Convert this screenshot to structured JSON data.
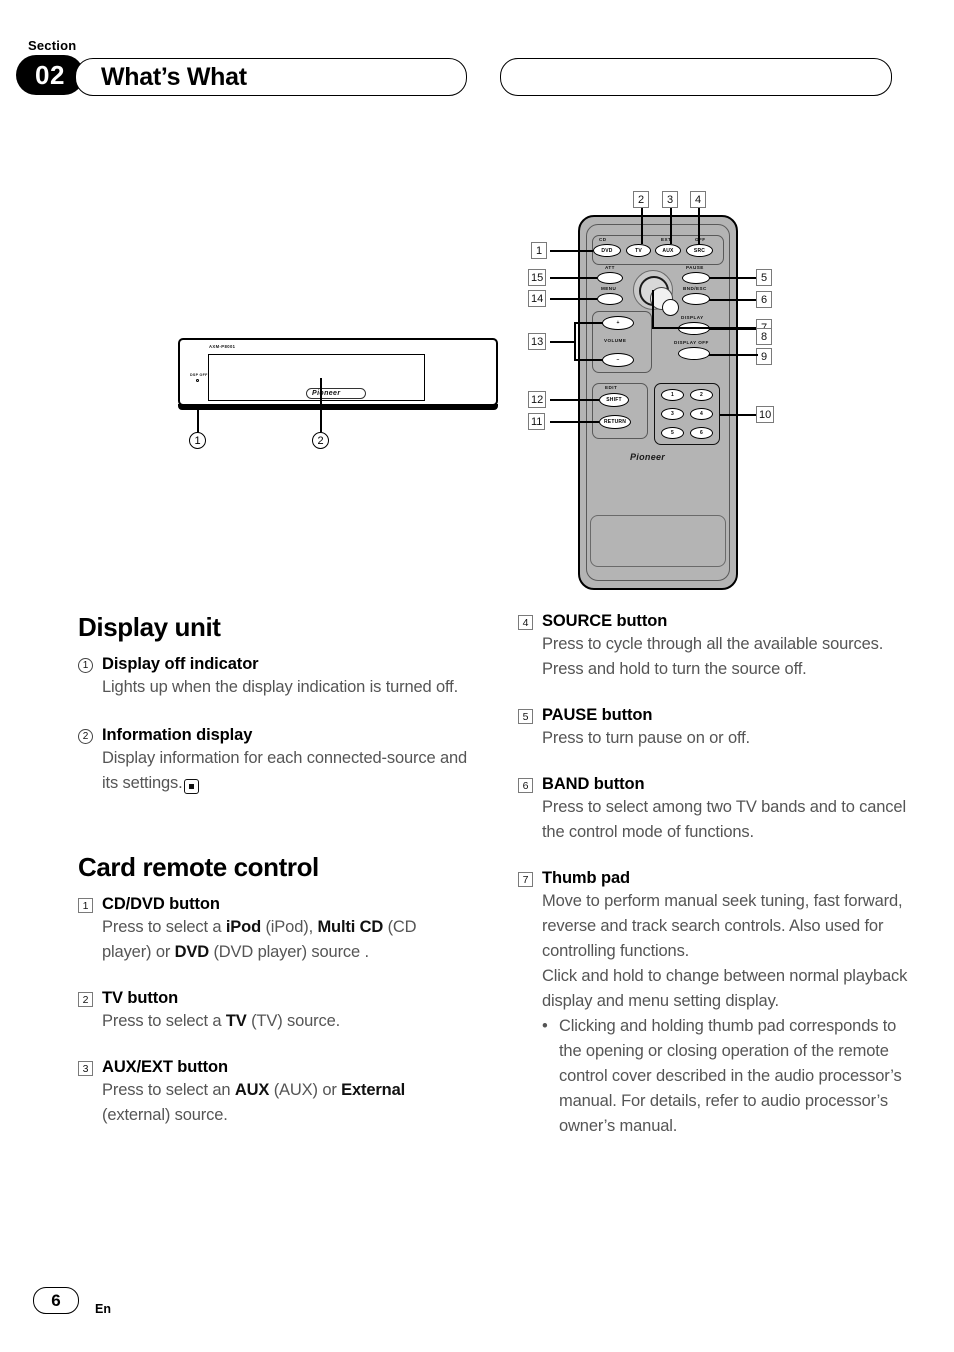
{
  "header": {
    "section_label": "Section",
    "section_number": "02",
    "title": "What’s What",
    "right_pill_text": ""
  },
  "figures": {
    "display_unit": {
      "model_text": "AXM-P8001",
      "dsp_off_text": "DSP OFF",
      "brand": "Pioneer",
      "callouts": [
        {
          "id": "du-1",
          "label": "1"
        },
        {
          "id": "du-2",
          "label": "2"
        }
      ]
    },
    "remote": {
      "brand": "Pioneer",
      "buttons": [
        {
          "name": "dvd",
          "label": "DVD",
          "top_label": "CD"
        },
        {
          "name": "tv",
          "label": "TV",
          "top_label": ""
        },
        {
          "name": "aux",
          "label": "AUX",
          "top_label": "EXT"
        },
        {
          "name": "src",
          "label": "SRC",
          "top_label": "OFF"
        },
        {
          "name": "att",
          "label": "",
          "top_label": "ATT"
        },
        {
          "name": "menu",
          "label": "",
          "top_label": "MENU"
        },
        {
          "name": "pause",
          "label": "",
          "top_label": "PAUSE"
        },
        {
          "name": "band-esc",
          "label": "",
          "top_label": "BND/ESC"
        },
        {
          "name": "display",
          "label": "",
          "top_label": "DISPLAY"
        },
        {
          "name": "display-off",
          "label": "",
          "top_label": "DISPLAY OFF"
        },
        {
          "name": "volume-up",
          "label": "+",
          "top_label": ""
        },
        {
          "name": "volume-down",
          "label": "–",
          "top_label": ""
        },
        {
          "name": "shift",
          "label": "SHIFT",
          "top_label": "EDIT"
        },
        {
          "name": "return",
          "label": "RETURN",
          "top_label": ""
        }
      ],
      "volume_label": "VOLUME",
      "numeric_keys": [
        "1",
        "2",
        "3",
        "4",
        "5",
        "6"
      ],
      "callouts": [
        {
          "n": "1"
        },
        {
          "n": "15"
        },
        {
          "n": "14"
        },
        {
          "n": "13"
        },
        {
          "n": "12"
        },
        {
          "n": "11"
        },
        {
          "n": "2"
        },
        {
          "n": "3"
        },
        {
          "n": "4"
        },
        {
          "n": "5"
        },
        {
          "n": "6"
        },
        {
          "n": "7"
        },
        {
          "n": "8"
        },
        {
          "n": "9"
        },
        {
          "n": "10"
        }
      ]
    }
  },
  "left_column": {
    "heading": "Display unit",
    "items": [
      {
        "marker": "1",
        "marker_style": "circle",
        "title": "Display off indicator",
        "body_html": "Lights up when the display indication is turned off."
      },
      {
        "marker": "2",
        "marker_style": "circle",
        "title": "Information display",
        "body_html": "Display information for each connected-source and its settings."
      }
    ],
    "heading2": "Card remote control",
    "items2": [
      {
        "marker": "1",
        "marker_style": "square",
        "title": "CD/DVD button",
        "body_html": "Press to select a <b>iPod</b> (iPod), <b>Multi CD</b> (CD player) or <b>DVD</b> (DVD player) source ."
      },
      {
        "marker": "2",
        "marker_style": "square",
        "title": "TV button",
        "body_html": "Press to select a <b>TV</b> (TV) source."
      },
      {
        "marker": "3",
        "marker_style": "square",
        "title": "AUX/EXT button",
        "body_html": "Press to select an <b>AUX</b> (AUX) or <b>External</b> (external) source."
      }
    ]
  },
  "right_column": {
    "items": [
      {
        "marker": "4",
        "marker_style": "square",
        "title": "SOURCE button",
        "body_html": "Press to cycle through all the available sources. Press and hold to turn the source off."
      },
      {
        "marker": "5",
        "marker_style": "square",
        "title": "PAUSE button",
        "body_html": "Press to turn pause on or off."
      },
      {
        "marker": "6",
        "marker_style": "square",
        "title": "BAND button",
        "body_html": "Press to select among two TV bands and to cancel the control mode of functions."
      },
      {
        "marker": "7",
        "marker_style": "square",
        "title": "Thumb pad",
        "body_html": "Move to perform manual seek tuning, fast forward, reverse and track search controls. Also used for controlling functions.<br>Click and hold to change between normal playback display and menu setting display.",
        "bullet": "Clicking and holding thumb pad corresponds to the opening or closing operation of the remote control cover described in the audio processor’s manual. For details, refer to audio processor’s owner’s manual."
      }
    ]
  },
  "footer": {
    "page_number": "6",
    "language": "En"
  }
}
